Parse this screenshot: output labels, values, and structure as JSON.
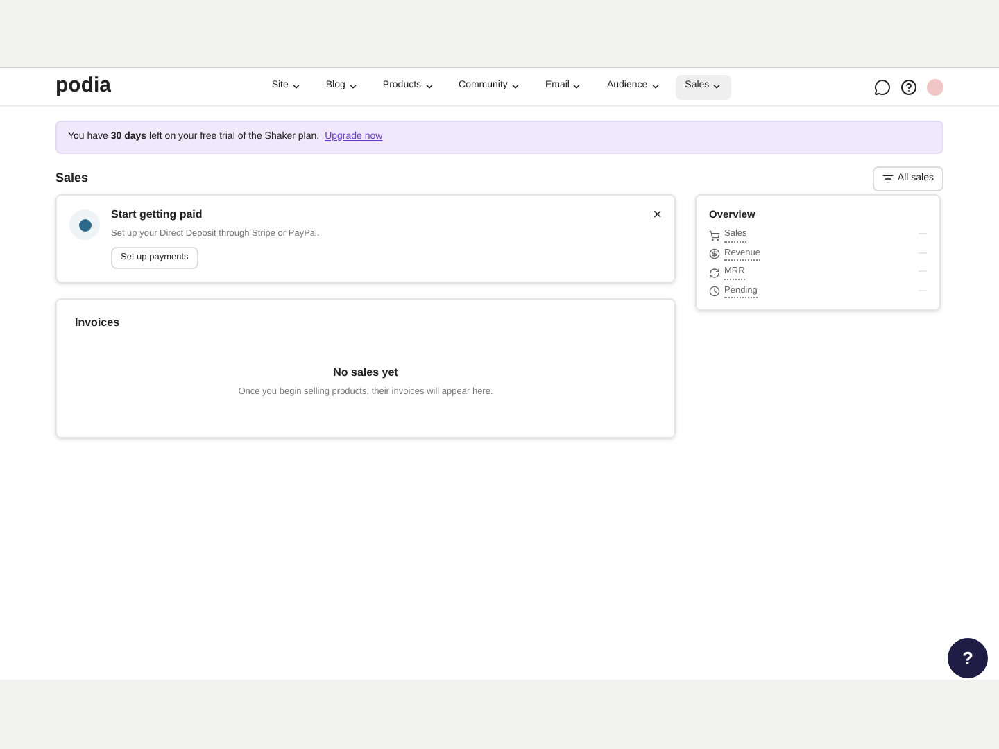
{
  "nav": {
    "logo": "podia",
    "items": [
      {
        "label": "Site",
        "selected": false
      },
      {
        "label": "Blog",
        "selected": false
      },
      {
        "label": "Products",
        "selected": false
      },
      {
        "label": "Community",
        "selected": false
      },
      {
        "label": "Email",
        "selected": false
      },
      {
        "label": "Audience",
        "selected": false
      },
      {
        "label": "Sales",
        "selected": true
      }
    ]
  },
  "banner": {
    "text": "You have **30 days** left on your free trial of the Shaker plan.",
    "link": "Upgrade now"
  },
  "page": {
    "title": "Sales",
    "filter": "All sales"
  },
  "payment_card": {
    "title": "Start getting paid",
    "text": "Set up your Direct Deposit through Stripe or PayPal.",
    "button": "Set up payments",
    "close": "×"
  },
  "invoices": {
    "title": "Invoices",
    "empty_title": "No sales yet",
    "empty_text": "Once you begin selling products, their invoices will appear here."
  },
  "overview": {
    "title": "Overview",
    "rows": [
      {
        "kind": "cart",
        "label": "Sales",
        "value": "—"
      },
      {
        "kind": "dollar",
        "label": "Revenue",
        "value": "—"
      },
      {
        "kind": "repeat",
        "label": "MRR",
        "value": "—"
      },
      {
        "kind": "clock",
        "label": "Pending",
        "value": "—"
      }
    ]
  },
  "help": "?"
}
